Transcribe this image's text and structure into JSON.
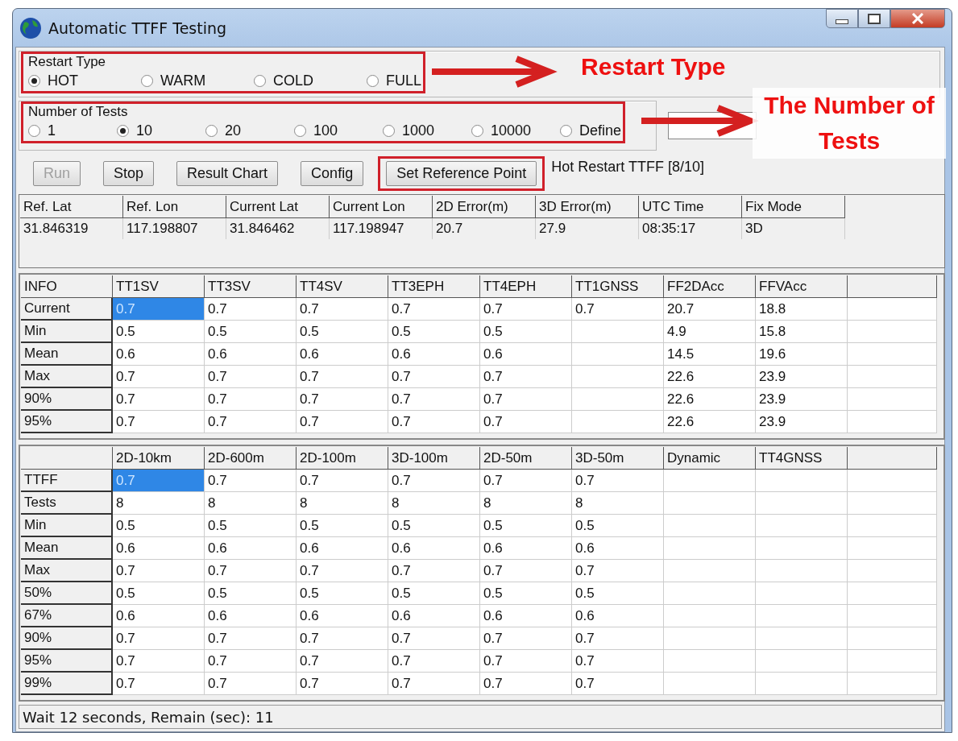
{
  "window": {
    "title": "Automatic TTFF Testing"
  },
  "restart_type": {
    "label": "Restart Type",
    "highlighted": true,
    "options": [
      {
        "label": "HOT",
        "selected": true
      },
      {
        "label": "WARM",
        "selected": false
      },
      {
        "label": "COLD",
        "selected": false
      },
      {
        "label": "FULL",
        "selected": false
      }
    ]
  },
  "number_of_tests": {
    "label": "Number of Tests",
    "highlighted": true,
    "options": [
      {
        "label": "1",
        "selected": false
      },
      {
        "label": "10",
        "selected": true
      },
      {
        "label": "20",
        "selected": false
      },
      {
        "label": "100",
        "selected": false
      },
      {
        "label": "1000",
        "selected": false
      },
      {
        "label": "10000",
        "selected": false
      },
      {
        "label": "Define",
        "selected": false
      }
    ]
  },
  "buttons": [
    {
      "label": "Run",
      "disabled": true,
      "highlighted": false
    },
    {
      "label": "Stop",
      "disabled": false,
      "highlighted": false
    },
    {
      "label": "Result Chart",
      "disabled": false,
      "highlighted": false
    },
    {
      "label": "Config",
      "disabled": false,
      "highlighted": false
    },
    {
      "label": "Set Reference Point",
      "disabled": false,
      "highlighted": true
    }
  ],
  "run_status": "Hot Restart TTFF [8/10]",
  "reference_table": {
    "columns": [
      "Ref. Lat",
      "Ref. Lon",
      "Current Lat",
      "Current Lon",
      "2D Error(m)",
      "3D Error(m)",
      "UTC Time",
      "Fix Mode"
    ],
    "rows": [
      [
        "31.846319",
        "117.198807",
        "31.846462",
        "117.198947",
        "20.7",
        "27.9",
        "08:35:17",
        "3D"
      ]
    ]
  },
  "info_table": {
    "corner": "INFO",
    "columns": [
      "TT1SV",
      "TT3SV",
      "TT4SV",
      "TT3EPH",
      "TT4EPH",
      "TT1GNSS",
      "FF2DAcc",
      "FFVAcc"
    ],
    "rows": [
      {
        "label": "Current",
        "cells": [
          {
            "text": "0.7",
            "selected": true
          },
          {
            "text": "0.7",
            "selected": false
          },
          {
            "text": "0.7",
            "selected": false
          },
          {
            "text": "0.7",
            "selected": false
          },
          {
            "text": "0.7",
            "selected": false
          },
          {
            "text": "0.7",
            "selected": false
          },
          {
            "text": "20.7",
            "selected": false
          },
          {
            "text": "18.8",
            "selected": false
          }
        ]
      },
      {
        "label": "Min",
        "cells": [
          {
            "text": "0.5",
            "selected": false
          },
          {
            "text": "0.5",
            "selected": false
          },
          {
            "text": "0.5",
            "selected": false
          },
          {
            "text": "0.5",
            "selected": false
          },
          {
            "text": "0.5",
            "selected": false
          },
          {
            "selected": false
          },
          {
            "text": "4.9",
            "selected": false
          },
          {
            "text": "15.8",
            "selected": false
          }
        ]
      },
      {
        "label": "Mean",
        "cells": [
          {
            "text": "0.6",
            "selected": false
          },
          {
            "text": "0.6",
            "selected": false
          },
          {
            "text": "0.6",
            "selected": false
          },
          {
            "text": "0.6",
            "selected": false
          },
          {
            "text": "0.6",
            "selected": false
          },
          {
            "selected": false
          },
          {
            "text": "14.5",
            "selected": false
          },
          {
            "text": "19.6",
            "selected": false
          }
        ]
      },
      {
        "label": "Max",
        "cells": [
          {
            "text": "0.7",
            "selected": false
          },
          {
            "text": "0.7",
            "selected": false
          },
          {
            "text": "0.7",
            "selected": false
          },
          {
            "text": "0.7",
            "selected": false
          },
          {
            "text": "0.7",
            "selected": false
          },
          {
            "selected": false
          },
          {
            "text": "22.6",
            "selected": false
          },
          {
            "text": "23.9",
            "selected": false
          }
        ]
      },
      {
        "label": "90%",
        "cells": [
          {
            "text": "0.7",
            "selected": false
          },
          {
            "text": "0.7",
            "selected": false
          },
          {
            "text": "0.7",
            "selected": false
          },
          {
            "text": "0.7",
            "selected": false
          },
          {
            "text": "0.7",
            "selected": false
          },
          {
            "selected": false
          },
          {
            "text": "22.6",
            "selected": false
          },
          {
            "text": "23.9",
            "selected": false
          }
        ]
      },
      {
        "label": "95%",
        "cells": [
          {
            "text": "0.7",
            "selected": false
          },
          {
            "text": "0.7",
            "selected": false
          },
          {
            "text": "0.7",
            "selected": false
          },
          {
            "text": "0.7",
            "selected": false
          },
          {
            "text": "0.7",
            "selected": false
          },
          {
            "selected": false
          },
          {
            "text": "22.6",
            "selected": false
          },
          {
            "text": "23.9",
            "selected": false
          }
        ]
      }
    ]
  },
  "ttff_table": {
    "columns": [
      "2D-10km",
      "2D-600m",
      "2D-100m",
      "3D-100m",
      "2D-50m",
      "3D-50m",
      "Dynamic",
      "TT4GNSS"
    ],
    "rows": [
      {
        "label": "TTFF",
        "cells": [
          {
            "text": "0.7",
            "selected": true
          },
          {
            "text": "0.7",
            "selected": false
          },
          {
            "text": "0.7",
            "selected": false
          },
          {
            "text": "0.7",
            "selected": false
          },
          {
            "text": "0.7",
            "selected": false
          },
          {
            "text": "0.7",
            "selected": false
          },
          {
            "selected": false
          },
          {
            "selected": false
          }
        ]
      },
      {
        "label": "Tests",
        "cells": [
          {
            "text": "8",
            "selected": false
          },
          {
            "text": "8",
            "selected": false
          },
          {
            "text": "8",
            "selected": false
          },
          {
            "text": "8",
            "selected": false
          },
          {
            "text": "8",
            "selected": false
          },
          {
            "text": "8",
            "selected": false
          },
          {
            "selected": false
          },
          {
            "selected": false
          }
        ]
      },
      {
        "label": "Min",
        "cells": [
          {
            "text": "0.5",
            "selected": false
          },
          {
            "text": "0.5",
            "selected": false
          },
          {
            "text": "0.5",
            "selected": false
          },
          {
            "text": "0.5",
            "selected": false
          },
          {
            "text": "0.5",
            "selected": false
          },
          {
            "text": "0.5",
            "selected": false
          },
          {
            "selected": false
          },
          {
            "selected": false
          }
        ]
      },
      {
        "label": "Mean",
        "cells": [
          {
            "text": "0.6",
            "selected": false
          },
          {
            "text": "0.6",
            "selected": false
          },
          {
            "text": "0.6",
            "selected": false
          },
          {
            "text": "0.6",
            "selected": false
          },
          {
            "text": "0.6",
            "selected": false
          },
          {
            "text": "0.6",
            "selected": false
          },
          {
            "selected": false
          },
          {
            "selected": false
          }
        ]
      },
      {
        "label": "Max",
        "cells": [
          {
            "text": "0.7",
            "selected": false
          },
          {
            "text": "0.7",
            "selected": false
          },
          {
            "text": "0.7",
            "selected": false
          },
          {
            "text": "0.7",
            "selected": false
          },
          {
            "text": "0.7",
            "selected": false
          },
          {
            "text": "0.7",
            "selected": false
          },
          {
            "selected": false
          },
          {
            "selected": false
          }
        ]
      },
      {
        "label": "50%",
        "cells": [
          {
            "text": "0.5",
            "selected": false
          },
          {
            "text": "0.5",
            "selected": false
          },
          {
            "text": "0.5",
            "selected": false
          },
          {
            "text": "0.5",
            "selected": false
          },
          {
            "text": "0.5",
            "selected": false
          },
          {
            "text": "0.5",
            "selected": false
          },
          {
            "selected": false
          },
          {
            "selected": false
          }
        ]
      },
      {
        "label": "67%",
        "cells": [
          {
            "text": "0.6",
            "selected": false
          },
          {
            "text": "0.6",
            "selected": false
          },
          {
            "text": "0.6",
            "selected": false
          },
          {
            "text": "0.6",
            "selected": false
          },
          {
            "text": "0.6",
            "selected": false
          },
          {
            "text": "0.6",
            "selected": false
          },
          {
            "selected": false
          },
          {
            "selected": false
          }
        ]
      },
      {
        "label": "90%",
        "cells": [
          {
            "text": "0.7",
            "selected": false
          },
          {
            "text": "0.7",
            "selected": false
          },
          {
            "text": "0.7",
            "selected": false
          },
          {
            "text": "0.7",
            "selected": false
          },
          {
            "text": "0.7",
            "selected": false
          },
          {
            "text": "0.7",
            "selected": false
          },
          {
            "selected": false
          },
          {
            "selected": false
          }
        ]
      },
      {
        "label": "95%",
        "cells": [
          {
            "text": "0.7",
            "selected": false
          },
          {
            "text": "0.7",
            "selected": false
          },
          {
            "text": "0.7",
            "selected": false
          },
          {
            "text": "0.7",
            "selected": false
          },
          {
            "text": "0.7",
            "selected": false
          },
          {
            "text": "0.7",
            "selected": false
          },
          {
            "selected": false
          },
          {
            "selected": false
          }
        ]
      },
      {
        "label": "99%",
        "cells": [
          {
            "text": "0.7",
            "selected": false
          },
          {
            "text": "0.7",
            "selected": false
          },
          {
            "text": "0.7",
            "selected": false
          },
          {
            "text": "0.7",
            "selected": false
          },
          {
            "text": "0.7",
            "selected": false
          },
          {
            "text": "0.7",
            "selected": false
          },
          {
            "selected": false
          },
          {
            "selected": false
          }
        ]
      }
    ]
  },
  "status_bar": "Wait 12 seconds, Remain (sec): 11",
  "annotations": [
    {
      "text": "Restart Type"
    },
    {
      "text": "The Number of Tests"
    }
  ]
}
